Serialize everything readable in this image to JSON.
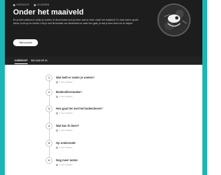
{
  "hero": {
    "meta": [
      {
        "icon": "grid-icon",
        "text": "OVERZICHT"
      },
      {
        "icon": "clock-icon",
        "text": "15 LESSEN"
      }
    ],
    "title": "Onder het maaiveld",
    "description": "En je bent welkom in onder je voeten. In deze lessen kun je meer over je meer onder het maaiveld. Er moet wat er groeit, leeuw, lucht op en breekt. Hoe je met dit bestaat van Nederland en waar ken gaat, je wat je kunt doen om te helpen.",
    "start_button": "Start product"
  },
  "tabs": [
    {
      "label": "OVERZICHT",
      "active": true
    },
    {
      "label": "MIJ AAN DE OL",
      "active": false
    }
  ],
  "steps": [
    {
      "num": "1",
      "title": "Wat leeft er onder je voeten?",
      "sub": "7 uur 4 lessen"
    },
    {
      "num": "2",
      "title": "Bodemdiersmaker!",
      "sub": "7 uur 4 lessen"
    },
    {
      "num": "3",
      "title": "Hoe gaat het met het bodemleven?",
      "sub": "7 uur 4 lessen"
    },
    {
      "num": "4",
      "title": "Wat kan ik doen?",
      "sub": "7 uur 4 lessen"
    },
    {
      "num": "5",
      "title": "Op onderzoek!",
      "sub": "7 uur 4 lessen"
    },
    {
      "num": "6",
      "title": "Nog meer weten",
      "sub": "7 uur 4 lessen"
    }
  ],
  "colors": {
    "accent_border": "#1cb5b5",
    "hero_bg": "#1d1d1d",
    "tab_bg": "#222222"
  }
}
